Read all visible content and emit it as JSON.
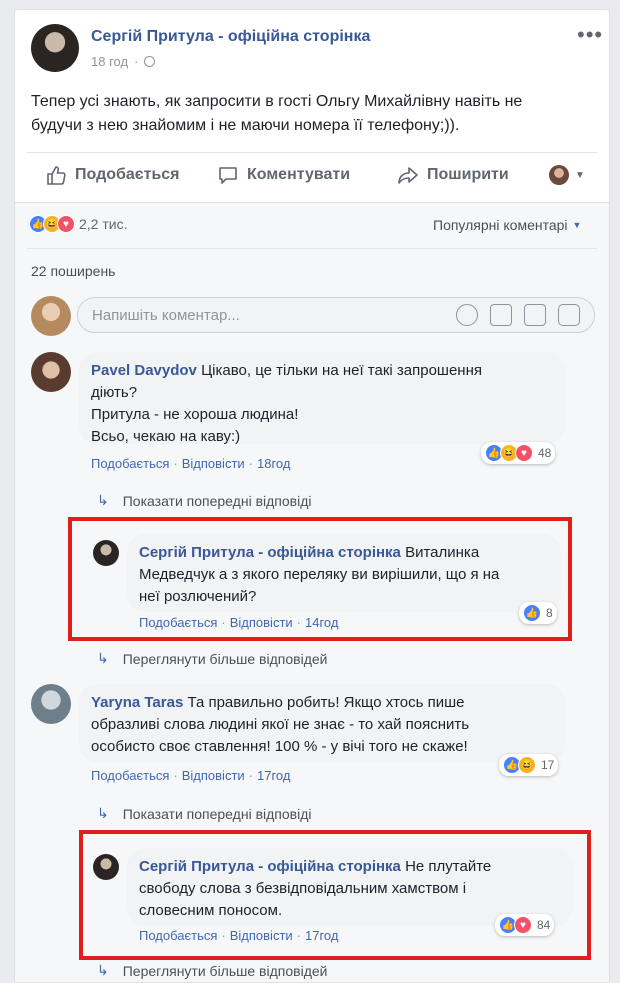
{
  "post": {
    "author": "Сергій Притула - офіційна сторінка",
    "time": "18 год",
    "globe_icon": "globe-icon",
    "more_icon": "•••",
    "text_line1": "Тепер усі знають, як запросити в гості Ольгу Михайлівну навіть не",
    "text_line2": "будучи з нею знайомим і не маючи номера її телефону;))."
  },
  "actions": {
    "like": "Подобається",
    "comment": "Коментувати",
    "share": "Поширити"
  },
  "summary": {
    "reactions_count": "2,2 тис.",
    "sort_label": "Популярні коментарі",
    "shares": "22 поширень"
  },
  "composer": {
    "placeholder": "Напишіть коментар..."
  },
  "meta_labels": {
    "like": "Подобається",
    "reply": "Відповісти",
    "sep": "·"
  },
  "comments": [
    {
      "author": "Pavel Davydov",
      "text_line1": "Цікаво, це тільки на неї такі запрошення",
      "text_line2": "діють?",
      "text_line3": "Притула - не хороша людина!",
      "text_line4": "Всьо, чекаю на каву:)",
      "time": "18год",
      "reactions": "48",
      "show_prev": "Показати попередні відповіді",
      "reply": {
        "author": "Сергій Притула - офіційна сторінка",
        "text_line1_rest": "Виталинка",
        "text_line2": "Медведчук а з якого переляку ви вирішили, що я на",
        "text_line3": "неї розлючений?",
        "time": "14год",
        "reactions": "8"
      },
      "view_more": "Переглянути більше відповідей"
    },
    {
      "author": "Yaryna Taras",
      "text_line1": "Та правильно робить! Якщо хтось пише",
      "text_line2": "образливі слова людині якої не знає - то хай пояснить",
      "text_line3": "особисто своє ставлення! 100 % - у вічі того не скаже!",
      "time": "17год",
      "reactions": "17",
      "show_prev": "Показати попередні відповіді",
      "reply": {
        "author": "Сергій Притула - офіційна сторінка",
        "text_line1_rest": "Не плутайте",
        "text_line2": "свободу слова з безвідповідальним хамством і",
        "text_line3": "словесним поносом.",
        "time": "17год",
        "reactions": "84"
      },
      "view_more": "Переглянути більше відповідей"
    }
  ],
  "colors": {
    "link": "#385898",
    "highlight": "#e01e1e"
  }
}
